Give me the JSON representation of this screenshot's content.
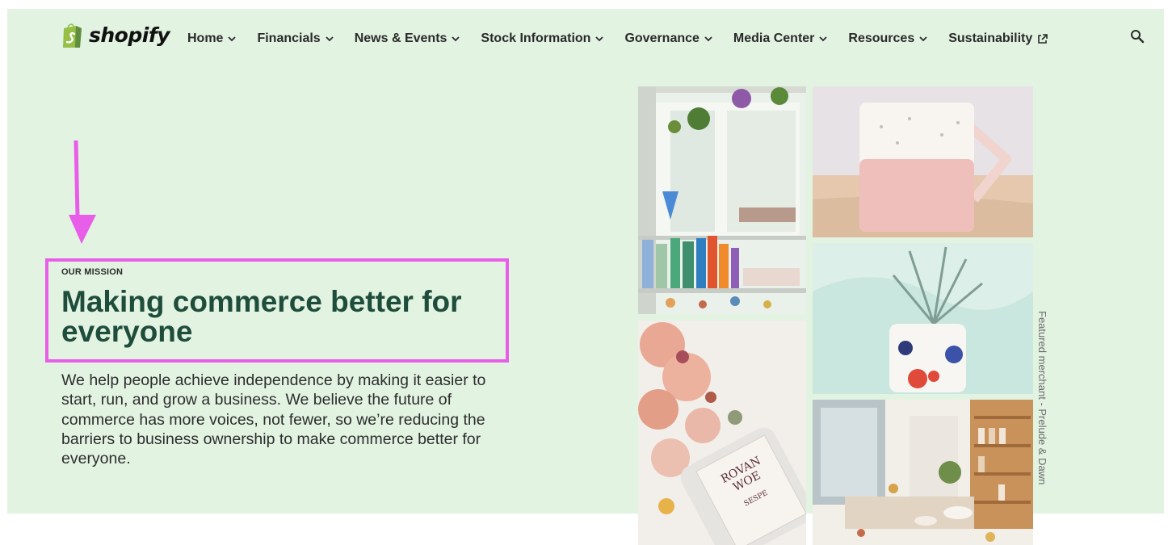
{
  "brand": {
    "name": "shopify",
    "colors": {
      "logo_green": "#95bf47",
      "logo_dark_green": "#5e8e3e",
      "hero_bg": "#e2f3e2",
      "headline": "#1f4d3c",
      "annotation_magenta": "#e85ee8"
    }
  },
  "nav": {
    "items": [
      {
        "label": "Home",
        "icon": "chevron-down-icon"
      },
      {
        "label": "Financials",
        "icon": "chevron-down-icon"
      },
      {
        "label": "News & Events",
        "icon": "chevron-down-icon"
      },
      {
        "label": "Stock Information",
        "icon": "chevron-down-icon"
      },
      {
        "label": "Governance",
        "icon": "chevron-down-icon"
      },
      {
        "label": "Media Center",
        "icon": "chevron-down-icon"
      },
      {
        "label": "Resources",
        "icon": "chevron-down-icon"
      },
      {
        "label": "Sustainability",
        "icon": "external-link-icon"
      }
    ],
    "search_icon": "search-icon"
  },
  "mission": {
    "eyebrow": "OUR MISSION",
    "headline": "Making commerce better for everyone",
    "body": "We help people achieve independence by making it easier to start, run, and grow a business. We believe the future of commerce has more voices, not fewer, so we’re reducing the barriers to business ownership to make commerce better for everyone."
  },
  "gallery": {
    "photos": [
      {
        "subject": "retail-shop-interior-glassware"
      },
      {
        "subject": "pink-ceramic-mug"
      },
      {
        "subject": "plant-in-floral-pot"
      },
      {
        "subject": "bath-salts-jar"
      },
      {
        "subject": "shop-shelves-interior"
      }
    ],
    "jar_label_text": [
      "ROVAN",
      "WOE",
      "SESPE"
    ],
    "credit": "Featured merchant - Prelude & Dawn"
  },
  "annotations": {
    "arrow": "down-arrow-annotation",
    "highlight_box": "mission-highlight-box"
  }
}
